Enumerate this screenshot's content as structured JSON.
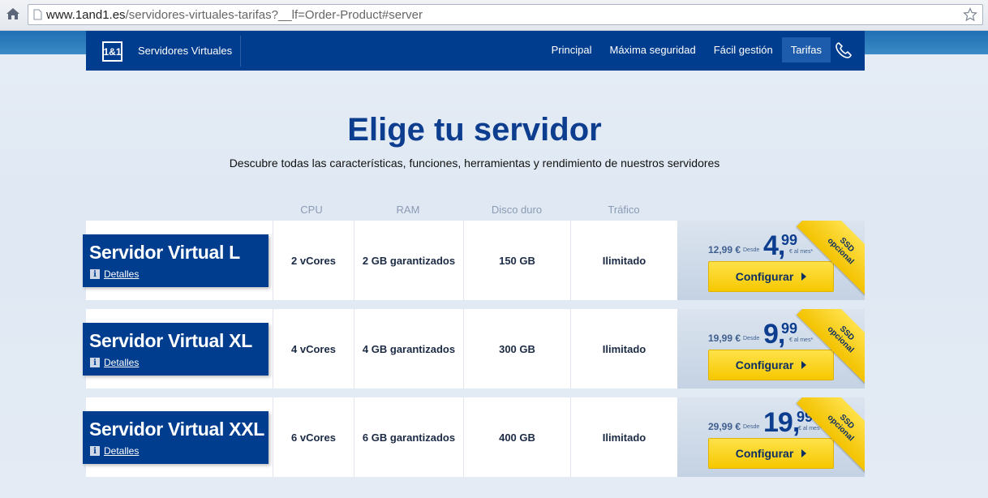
{
  "browser": {
    "url_host": "www.1and1.es",
    "url_path": "/servidores-virtuales-tarifas?__lf=Order-Product#server"
  },
  "nav": {
    "logo": "1&1",
    "brand": "Servidores Virtuales",
    "items": [
      {
        "label": "Principal",
        "active": false
      },
      {
        "label": "Máxima seguridad",
        "active": false
      },
      {
        "label": "Fácil gestión",
        "active": false
      },
      {
        "label": "Tarifas",
        "active": true
      }
    ]
  },
  "hero": {
    "title": "Elige tu servidor",
    "subtitle": "Descubre todas las características, funciones, herramientas y rendimiento de nuestros servidores"
  },
  "columns": [
    "CPU",
    "RAM",
    "Disco duro",
    "Tráfico"
  ],
  "plans": [
    {
      "name": "Servidor Virtual L",
      "details": "Detalles",
      "cpu": "2 vCores",
      "ram": "2 GB garantizados",
      "disk": "150 GB",
      "traffic": "Ilimitado",
      "old_price": "12,99 €",
      "desde": "Desde",
      "price_int": "4,",
      "price_cents": "99",
      "per_month": "€ al mes*",
      "button": "Configurar",
      "ribbon_1": "SSD",
      "ribbon_2": "opcional"
    },
    {
      "name": "Servidor Virtual XL",
      "details": "Detalles",
      "cpu": "4 vCores",
      "ram": "4 GB garantizados",
      "disk": "300 GB",
      "traffic": "Ilimitado",
      "old_price": "19,99 €",
      "desde": "Desde",
      "price_int": "9,",
      "price_cents": "99",
      "per_month": "€ al mes*",
      "button": "Configurar",
      "ribbon_1": "SSD",
      "ribbon_2": "opcional"
    },
    {
      "name": "Servidor Virtual XXL",
      "details": "Detalles",
      "cpu": "6 vCores",
      "ram": "6 GB garantizados",
      "disk": "400 GB",
      "traffic": "Ilimitado",
      "old_price": "29,99 €",
      "desde": "Desde",
      "price_int": "19,",
      "price_cents": "99",
      "per_month": "€ al mes*",
      "button": "Configurar",
      "ribbon_1": "SSD",
      "ribbon_2": "opcional"
    }
  ]
}
